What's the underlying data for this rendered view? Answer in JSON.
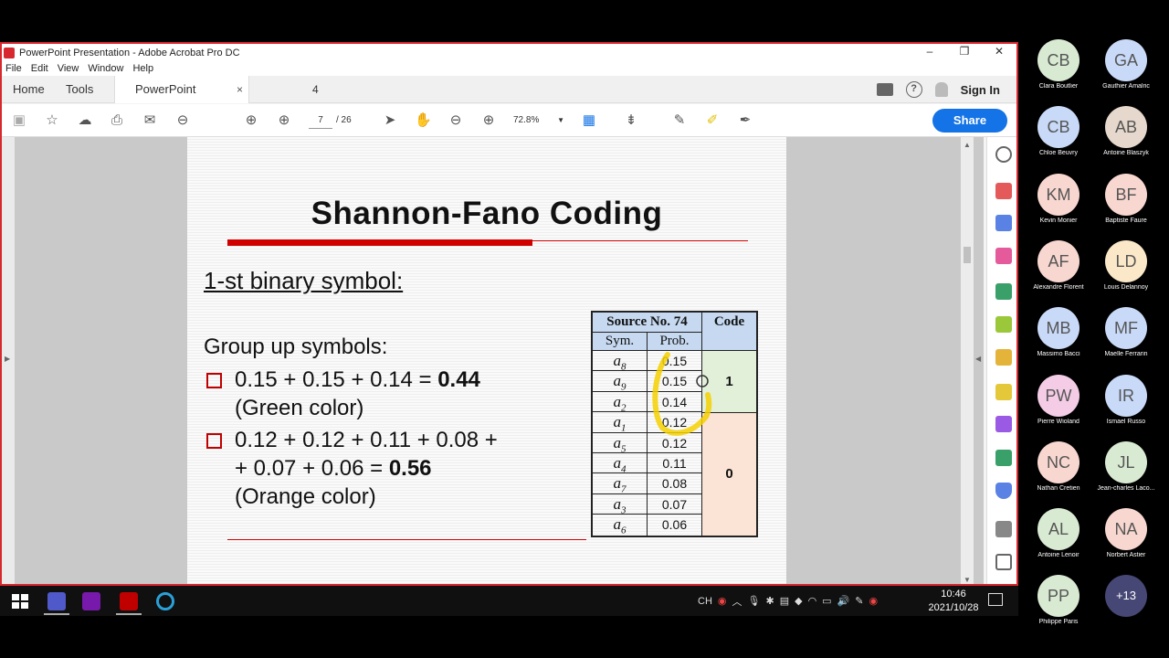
{
  "window": {
    "title": "PowerPoint Presentation - Adobe Acrobat Pro DC",
    "controls": [
      "–",
      "❐",
      "✕"
    ]
  },
  "menu": [
    "File",
    "Edit",
    "View",
    "Window",
    "Help"
  ],
  "tabs": {
    "home": "Home",
    "tools": "Tools",
    "doc": "PowerPoint Present...",
    "doc_close": "×",
    "page_indicator": "4"
  },
  "header_right": {
    "help": "?",
    "signin": "Sign In"
  },
  "toolbar": {
    "page_current": "7",
    "page_total": "/  26",
    "zoom": "72.8%",
    "share": "Share"
  },
  "slide": {
    "title": "Shannon-Fano Coding",
    "subhead": "1-st binary symbol:",
    "group_label": "Group up symbols:",
    "bullet1_line1_plain": "0.15 + 0.15 + 0.14 = ",
    "bullet1_line1_bold": "0.44",
    "bullet1_line2": "(Green color)",
    "bullet2_line1": "0.12 + 0.12 + 0.11 + 0.08 +",
    "bullet2_line2_plain": "+ 0.07 + 0.06 = ",
    "bullet2_line2_bold": "0.56",
    "bullet2_line3": "(Orange color)"
  },
  "table": {
    "source_header": "Source No. 74",
    "code_header": "Code",
    "sym_header": "Sym.",
    "prob_header": "Prob.",
    "rows": [
      {
        "sym": "a",
        "sub": "8",
        "prob": "0.15"
      },
      {
        "sym": "a",
        "sub": "9",
        "prob": "0.15"
      },
      {
        "sym": "a",
        "sub": "2",
        "prob": "0.14"
      },
      {
        "sym": "a",
        "sub": "1",
        "prob": "0.12"
      },
      {
        "sym": "a",
        "sub": "5",
        "prob": "0.12"
      },
      {
        "sym": "a",
        "sub": "4",
        "prob": "0.11"
      },
      {
        "sym": "a",
        "sub": "7",
        "prob": "0.08"
      },
      {
        "sym": "a",
        "sub": "3",
        "prob": "0.07"
      },
      {
        "sym": "a",
        "sub": "6",
        "prob": "0.06"
      }
    ],
    "code_top": "1",
    "code_bottom": "0"
  },
  "taskbar": {
    "lang": "CH",
    "time": "10:46",
    "date": "2021/10/28"
  },
  "participants": [
    {
      "initials": "CB",
      "name": "Clara Boutlier",
      "color": "#d9ead3"
    },
    {
      "initials": "GA",
      "name": "Gauthier Amalric",
      "color": "#c9daf8"
    },
    {
      "initials": "CB",
      "name": "Chloe Beuvry",
      "color": "#c9daf8"
    },
    {
      "initials": "AB",
      "name": "Antoine Blaszyk",
      "color": "#e6d8cc"
    },
    {
      "initials": "KM",
      "name": "Kevin Monier",
      "color": "#f8d7d0"
    },
    {
      "initials": "BF",
      "name": "Baptiste Faure",
      "color": "#f8d7d0"
    },
    {
      "initials": "AF",
      "name": "Alexandre Florent",
      "color": "#f8d7d0"
    },
    {
      "initials": "LD",
      "name": "Louis Delannoy",
      "color": "#fbe8c8"
    },
    {
      "initials": "MB",
      "name": "Massimo Bacci",
      "color": "#c9daf8"
    },
    {
      "initials": "MF",
      "name": "Maelle Ferrarin",
      "color": "#c9daf8"
    },
    {
      "initials": "PW",
      "name": "Pierre Wioland",
      "color": "#f4cce6"
    },
    {
      "initials": "IR",
      "name": "Ismael Russo",
      "color": "#c9daf8"
    },
    {
      "initials": "NC",
      "name": "Nathan Cretien",
      "color": "#f8d7d0"
    },
    {
      "initials": "JL",
      "name": "Jean-charles Laco...",
      "color": "#d9ead3"
    },
    {
      "initials": "AL",
      "name": "Antoine Lenoir",
      "color": "#d9ead3"
    },
    {
      "initials": "NA",
      "name": "Norbert Astier",
      "color": "#f8d7d0"
    },
    {
      "initials": "PP",
      "name": "Philippe Paris",
      "color": "#d9ead3"
    },
    {
      "initials": "+13",
      "name": "",
      "color": "#464775"
    }
  ]
}
